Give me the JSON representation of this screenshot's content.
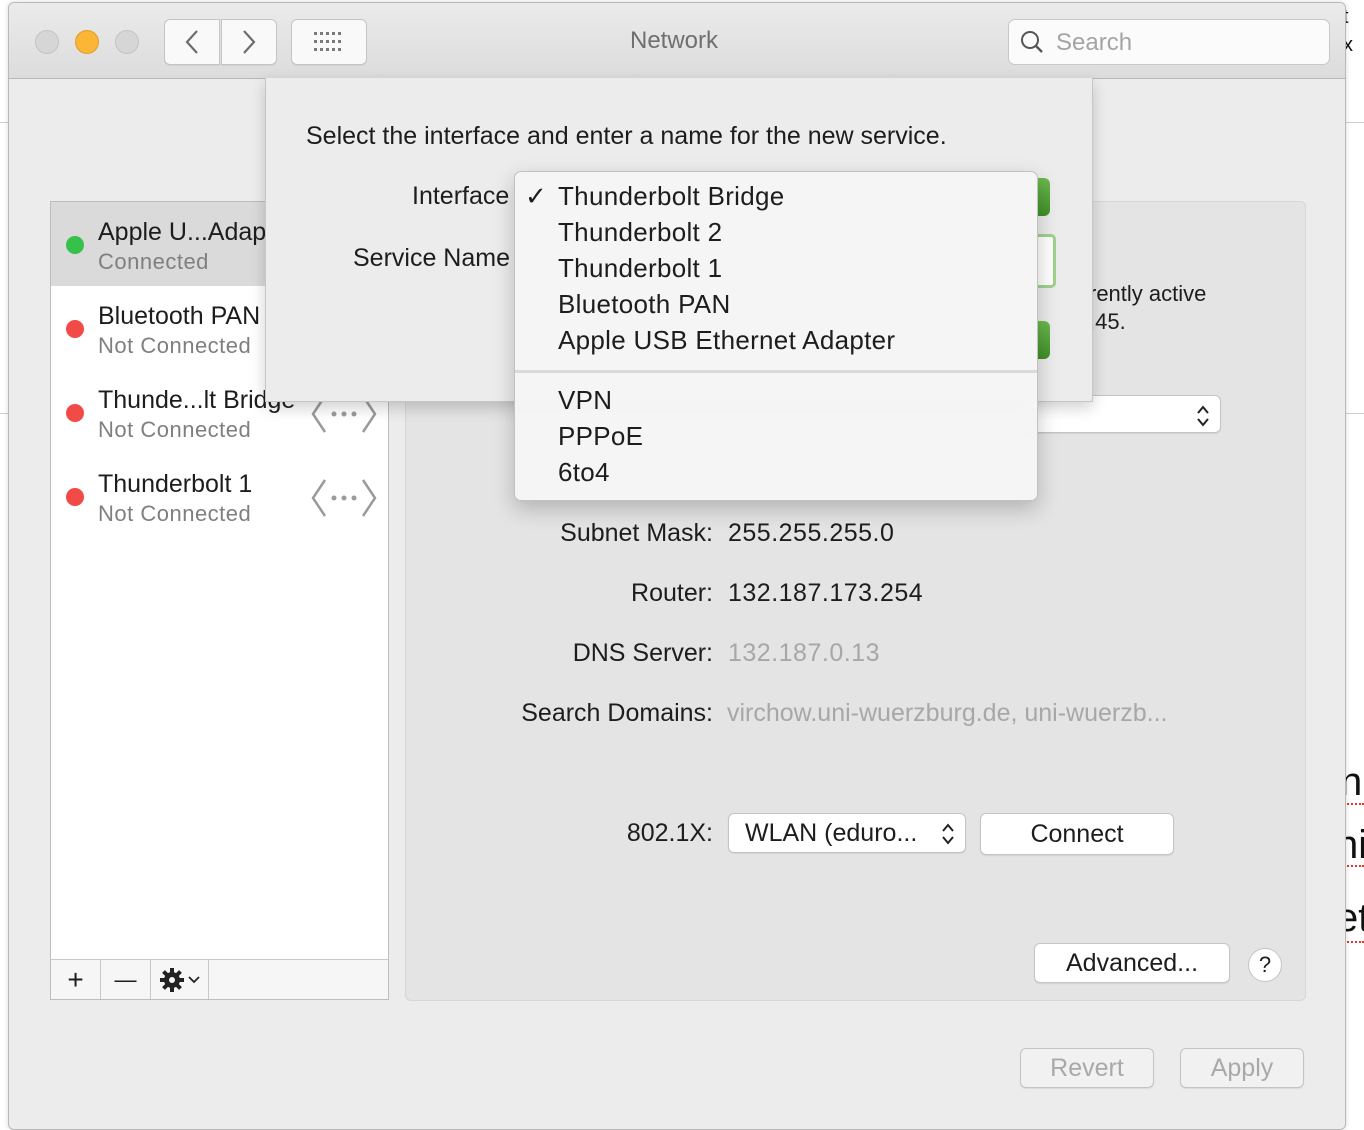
{
  "window": {
    "title": "Network"
  },
  "search": {
    "placeholder": "Search"
  },
  "services": [
    {
      "name": "Apple U...Adap",
      "status": "Connected",
      "color": "#35c14a"
    },
    {
      "name": "Bluetooth PAN",
      "status": "Not Connected",
      "color": "#f24b47"
    },
    {
      "name": "Thunde...lt Bridge",
      "status": "Not Connected",
      "color": "#f24b47"
    },
    {
      "name": "Thunderbolt 1",
      "status": "Not Connected",
      "color": "#f24b47"
    }
  ],
  "sidebar_toolbar": {
    "add": "+",
    "remove": "—"
  },
  "details": {
    "info_line1": "rently active",
    "info_line2": ".45.",
    "subnet_label": "Subnet Mask:",
    "subnet_value": "255.255.255.0",
    "router_label": "Router:",
    "router_value": "132.187.173.254",
    "dns_label": "DNS Server:",
    "dns_value": "132.187.0.13",
    "domains_label": "Search Domains:",
    "domains_value": "virchow.uni-wuerzburg.de, uni-wuerzb...",
    "dot1x_label": "802.1X:",
    "dot1x_value": "WLAN (eduro...",
    "connect_button": "Connect",
    "advanced_button": "Advanced...",
    "help_button": "?"
  },
  "footer": {
    "revert": "Revert",
    "apply": "Apply"
  },
  "sheet": {
    "message": "Select the interface and enter a name for the new service.",
    "interface_label": "Interface",
    "service_name_label": "Service Name"
  },
  "menu": {
    "checkmark": "✓",
    "items": [
      "Thunderbolt Bridge",
      "Thunderbolt 2",
      "Thunderbolt 1",
      "Bluetooth PAN",
      "Apple USB Ethernet Adapter"
    ],
    "items2": [
      "VPN",
      "PPPoE",
      "6to4"
    ]
  },
  "background": {
    "frag1": "t",
    "frag2": "x",
    "frag3": "n",
    "frag4": "ni",
    "frag5": "et"
  }
}
